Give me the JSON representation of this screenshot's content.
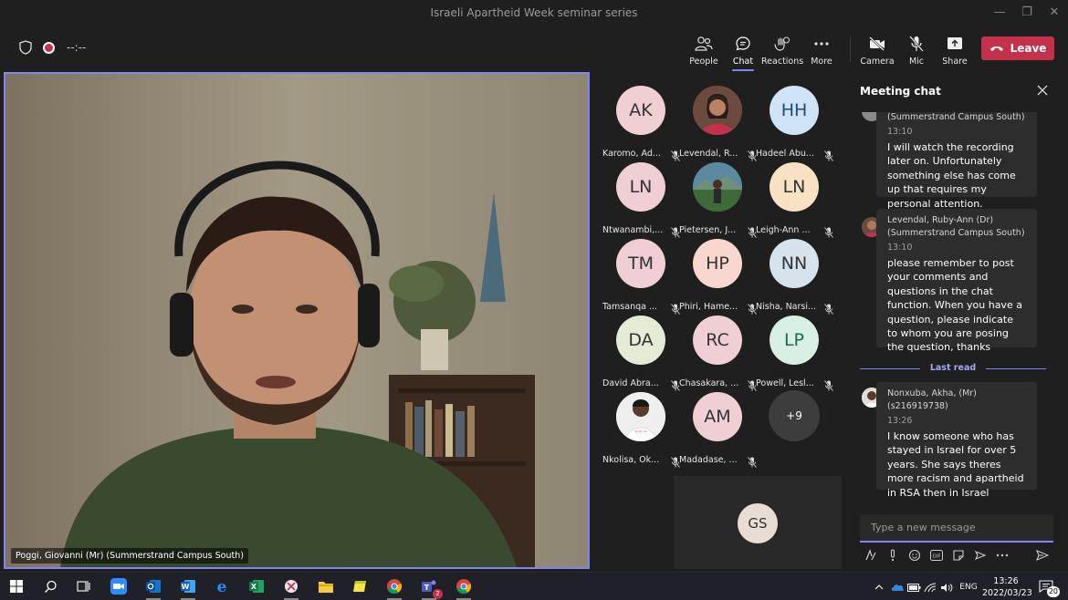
{
  "window": {
    "title": "Israeli Apartheid Week seminar series"
  },
  "toolbar": {
    "timer": "--:--",
    "buttons": [
      {
        "label": "People",
        "icon": "people-icon"
      },
      {
        "label": "Chat",
        "icon": "chat-icon",
        "active": true
      },
      {
        "label": "Reactions",
        "icon": "reactions-icon"
      },
      {
        "label": "More",
        "icon": "more-icon"
      },
      {
        "label": "Camera",
        "icon": "camera-off-icon"
      },
      {
        "label": "Mic",
        "icon": "mic-off-icon"
      },
      {
        "label": "Share",
        "icon": "share-icon"
      }
    ],
    "leave_label": "Leave"
  },
  "main_video": {
    "name": "Poggi, Giovanni (Mr) (Summerstrand Campus South)"
  },
  "gallery": {
    "participants": [
      {
        "initials": "AK",
        "name": "Karomo, Ad...",
        "color": "#efcfd3",
        "text_color": "#333"
      },
      {
        "initials": "",
        "name": "Levendal, R...",
        "color": "#6b4b3e",
        "photo": true
      },
      {
        "initials": "HH",
        "name": "Hadeel Abu...",
        "color": "#cfe4f8",
        "text_color": "#1e4b7a"
      },
      {
        "initials": "LN",
        "name": "Ntwanambi,...",
        "color": "#efcfd3",
        "text_color": "#333"
      },
      {
        "initials": "",
        "name": "Pietersen, J...",
        "color": "#3f6a7a",
        "photo": true
      },
      {
        "initials": "LN",
        "name": "Leigh-Ann ...",
        "color": "#f9e2c3",
        "text_color": "#333"
      },
      {
        "initials": "TM",
        "name": "Tamsanqa ...",
        "color": "#efcfd3",
        "text_color": "#333"
      },
      {
        "initials": "HP",
        "name": "Phiri, Hame...",
        "color": "#f8d7cf",
        "text_color": "#333"
      },
      {
        "initials": "NN",
        "name": "Nisha, Narsi...",
        "color": "#d6e2ec",
        "text_color": "#333"
      },
      {
        "initials": "DA",
        "name": "David Abra...",
        "color": "#e4ecd6",
        "text_color": "#333"
      },
      {
        "initials": "RC",
        "name": "Chasakara, ...",
        "color": "#efcfd3",
        "text_color": "#333"
      },
      {
        "initials": "LP",
        "name": "Powell, Lesl...",
        "color": "#d7f0e3",
        "text_color": "#1e6b4b"
      },
      {
        "initials": "",
        "name": "Nkolisa, Ok...",
        "color": "#e8e8e8",
        "photo": true
      },
      {
        "initials": "AM",
        "name": "Madadase, ...",
        "color": "#efcfd3",
        "text_color": "#333"
      }
    ],
    "overflow_count": "+9",
    "self_initials": "GS"
  },
  "chat": {
    "title": "Meeting chat",
    "messages": [
      {
        "sender": "(Summerstrand Campus South)",
        "time": "13:10",
        "body": "I will watch the recording later on. Unfortunately something else has come up that requires my personal attention."
      },
      {
        "sender": "Levendal, Ruby-Ann (Dr) (Summerstrand Campus South)",
        "time": "13:10",
        "body": "please remember to post your comments and questions in the chat function. When you have a question, please indicate to whom you are posing the question, thanks"
      },
      {
        "sender": "Nonxuba, Akha, (Mr) (s216919738)",
        "time": "13:26",
        "body": "I know someone who has stayed in Israel for over 5 years. She says theres more racism and apartheid in RSA then in Israel"
      }
    ],
    "last_read_label": "Last read",
    "compose_placeholder": "Type a new message"
  },
  "taskbar": {
    "language": "ENG",
    "time": "13:26",
    "date": "2022/03/23",
    "notification_count": "20",
    "teams_badge": "2"
  }
}
